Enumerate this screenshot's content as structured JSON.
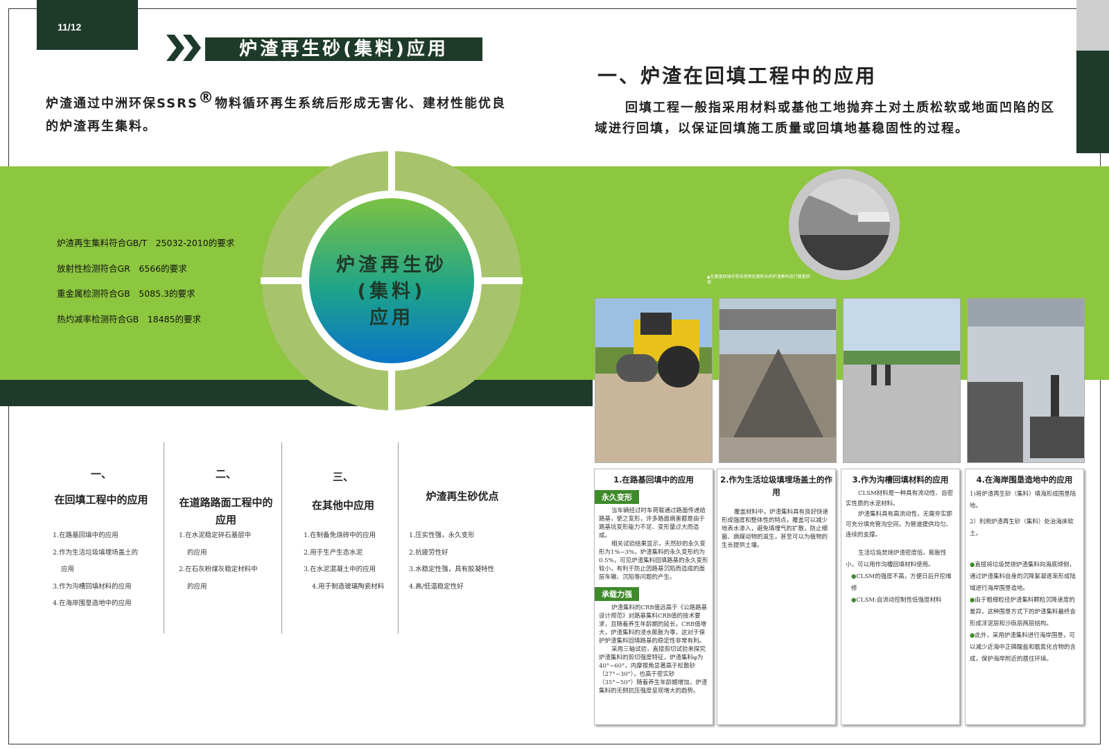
{
  "page": {
    "number": "11/12"
  },
  "header": {
    "title": "炉渣再生砂(集料)应用"
  },
  "intro": {
    "before": "炉渣通过中洲环保SSRS",
    "reg": "®",
    "after": "物料循环再生系统后形成无害化、建材性能优良的炉渣再生集料。"
  },
  "right_section": {
    "title": "一、炉渣在回填工程中的应用",
    "body": "回填工程一般指采用材料或基他工地抛弃土对土质松软或地面凹陷的区域进行回填，以保证回填施工质量或回填地基稳固性的过程。"
  },
  "center_circle": {
    "line1": "炉渣再生砂",
    "line2": "(集料)",
    "line3": "应用"
  },
  "requirements": [
    "炉渣再生集料符合GB/T　25032-2010的要求",
    "放射性检测符合GR　6566的要求",
    "重金属检测符合GB　5085.3的要求",
    "热灼减率检测符合GB　18485的要求"
  ],
  "circle_photo_caption": "▲在路基回填中是采用熟化期较长的炉渣集料进行路基回填",
  "cards": [
    {
      "title": "1.在路基回填中的应用",
      "tag1": "永久变形",
      "para1": "当车辆经过时车荷载通过路面传递给路基，使之变形，许多路面病害都是由于路基坑变形能力不足、变形量过大而造成。",
      "para2": "相关试验结果显示，天然砂的永久变形为1%~3%，炉渣集料的永久变形约为0.5%，可见炉渣集料回填路基的永久变形较小，有利于防止因路基沉陷而造成的面层车辙、沉陷等问题的产生。",
      "tag2": "承载力强",
      "para3": "炉渣集料的CRB值远高于《公路路基设计规范》对路基集料CRB值的技术要求，且随着养生年龄期的延长，CRB值增大，炉渣集料的浸水膨胀为零，这对于保护炉渣集料回填路基的稳定性非常有利。",
      "para4": "采用三轴试验，直接剪切试验来探究炉渣集料的剪切强度特征，炉渣集料φ为40°~60°，内摩擦角显著高于松散砂（27°~30°），也高于密实砂（35°~50°）随着养生年龄期增加，炉渣集料的无侧抗压强度呈现增大的趋势。"
    },
    {
      "title": "2.作为生活垃圾填埋场盖土的作用",
      "para1": "覆盖材料中，炉渣集料具有良好快速形成强度和整体性的特点，覆盖可以减少地表水渗入，避免填埋气的扩散，防止细菌、病媒动物的滋生，甚至可以为植物的生长提供土壤。"
    },
    {
      "title": "3.作为沟槽回填材料的应用",
      "para1": "CLSM材料是一种具有流动性、自密实性质的水泥材料。",
      "para2": "炉渣集料具有高流动性，无需夯实即可充分填充管沟空间，为管道提供均匀、连续的支撑。",
      "para3": "生活垃圾焚烧炉渣密度低、膨胀性小，可以用作沟槽回填材料使用。",
      "b1": "CLSM的强度不高，方便日后开挖维修",
      "b2": "CLSM:自流动控制性低强度材料"
    },
    {
      "title": "4.在海岸围垦造地中的应用",
      "p1": "1)将炉渣再生砂（集料）填海形成围垦陆地。",
      "p2": "2）利用炉渣再生砂（集料）处治海床软土。",
      "b1": "直接将垃圾焚烧炉渣集料向海底倾倒，通过炉渣集料自身的沉降絮凝逐渐形成陆域进行海岸围垦造地。",
      "b2": "由于粗细粒径炉渣集料颗粒沉降速度的差异，这种围垦方式下的炉渣集料最终会形成浮泥层和沙砾层两层结构。",
      "b3": "此外，采用炉渣集料进行海岸围垦，可以减少近海中正磷酸盐和氨氮化合物的含成，保护海岸附近的居住环境。"
    }
  ],
  "columns": [
    {
      "num": "一、",
      "title": "在回填工程中的应用",
      "items": [
        "1.在路基回填中的应用",
        "2.作为生活垃圾填埋场盖土的",
        "应用",
        "3.作为沟槽回填材料的应用",
        "4.在海岸围垦造地中的应用"
      ]
    },
    {
      "num": "二、",
      "title": "在道路路面工程中的应用",
      "items": [
        "1.在水泥稳定碎石基层中",
        "的应用",
        "2.在石灰粉煤灰稳定材料中",
        "的应用"
      ]
    },
    {
      "num": "三、",
      "title": "在其他中应用",
      "items": [
        "1.在制备免烧砖中的应用",
        "2.用于生产生态水泥",
        "3.在水泥混凝土中的应用",
        "4.用于制造玻璃陶瓷材料"
      ]
    },
    {
      "num": "",
      "title": "炉渣再生砂优点",
      "items": [
        "1.压实性强，永久变形",
        "2.抗疲劳性好",
        "3.水稳定性强，具有胶凝特性",
        "4.高/低温稳定性好"
      ]
    }
  ],
  "colors": {
    "dark_green": "#1e3a2a",
    "light_green": "#8dc63f",
    "accent_green": "#3f8a2c"
  }
}
